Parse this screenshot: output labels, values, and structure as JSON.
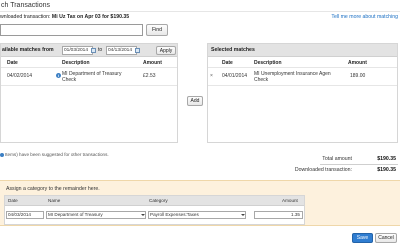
{
  "window": {
    "title": "ch Transactions"
  },
  "downloaded": {
    "label": "wnloaded transaction:",
    "value": "Mi Uz Tax on Apr 03 for $190.35"
  },
  "help_link": "Tell me more about matching",
  "find": {
    "button": "Find",
    "value": ""
  },
  "available": {
    "header_prefix": "ailable matches from",
    "from_date": "01/03/2014",
    "to_label": "to",
    "to_date": "04/13/2014",
    "apply_label": "Apply",
    "columns": [
      "Date",
      "Description",
      "Amount"
    ],
    "rows": [
      {
        "date": "04/02/2014",
        "description_l1": "MI Department of Treasury",
        "description_l2": "Check",
        "amount": "£2.53"
      }
    ]
  },
  "add_label": "Add",
  "selected": {
    "header": "Selected matches",
    "columns": [
      "Date",
      "Description",
      "Amount"
    ],
    "rows": [
      {
        "date": "04/01/2014",
        "description_l1": "MI Unemployment Insurance Agen",
        "description_l2": "Check",
        "amount": "189.00"
      }
    ]
  },
  "note": "Items) have been suggested for other transactions.",
  "totals": {
    "total_label": "Total amount",
    "total_value": "$190.35",
    "downloaded_label": "Downloaded transaction:",
    "downloaded_value": "$190.35"
  },
  "assign": {
    "title": "Assign a category to the remainder here.",
    "columns": [
      "Date",
      "Name",
      "Category",
      "Amount"
    ],
    "row": {
      "date": "04/03/2014",
      "name": "MI Department of Treasury",
      "category": "Payroll Expenses:Taxes",
      "amount": "1.35"
    }
  },
  "buttons": {
    "save": "Save",
    "cancel": "Cancel"
  },
  "colors": {
    "accent": "#2f7dd1",
    "link": "#1a6fc4",
    "assign_bg": "#fdf1dd",
    "header_bg": "#e3e3e3"
  }
}
